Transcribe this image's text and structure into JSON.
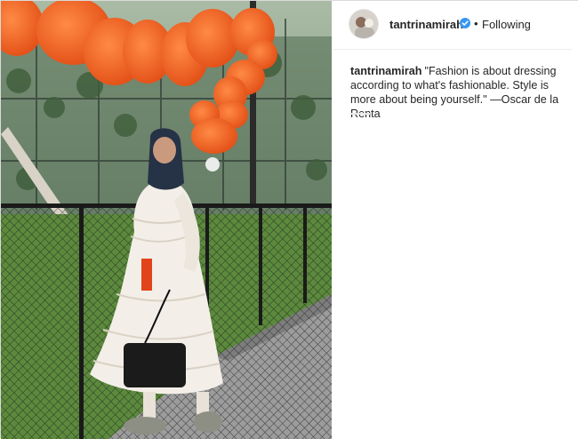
{
  "post": {
    "author": {
      "username": "tantrinamirah",
      "verified": true,
      "separator": "•",
      "follow_status": "Following"
    },
    "caption": {
      "username": "tantrinamirah",
      "text": "\"Fashion is about dressing according to what's fashionable. Style is more about being yourself.\" —Oscar de la Renta"
    }
  },
  "icons": {
    "verified": "verified-badge-icon"
  },
  "colors": {
    "verified_blue": "#3897f0",
    "text": "#262626",
    "border": "#dbdbdb",
    "lantern_orange": "#f0631e"
  }
}
